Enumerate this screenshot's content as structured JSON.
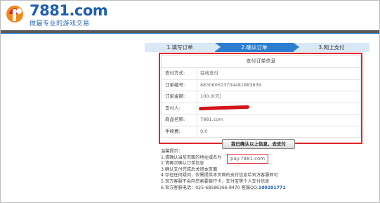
{
  "header": {
    "logo_name": "7881.com",
    "slogan": "做最专业的游戏交易",
    "colors": {
      "brand_blue": "#1e5fae",
      "logo_orange": "#f08a1c",
      "logo_red": "#d8272d"
    }
  },
  "steps": [
    {
      "label": "1.填写订单"
    },
    {
      "label": "2.确认订单",
      "active": true
    },
    {
      "label": "3.网上支付"
    }
  ],
  "order_info": {
    "title": "支付订单信息",
    "rows": [
      {
        "label": "支付方式:",
        "value": "在线支付"
      },
      {
        "label": "订单编号:",
        "value": "883060613704481883639"
      },
      {
        "label": "订单金额:",
        "value": "100.0(元)"
      },
      {
        "label": "支付人:",
        "value": ""
      },
      {
        "label": "商品名称:",
        "value": "7881.com"
      },
      {
        "label": "手续费:",
        "value": "0.0"
      }
    ],
    "confirm_button": "我已确认以上信息，去支付"
  },
  "tips": {
    "title": "温馨提示：",
    "line1": "1.请确认当前页面的地址域名为",
    "domain": "pay.7881.com",
    "line2": "2.请再次确认订单信息",
    "line3": "3.确认支付完成后关闭本页面",
    "line4": "4.存在任何疑问，仅需提供本页面的支付信息给官方客服即可",
    "line5": "5.官方客服不会向您索要银行卡，支付宝等个人支付信息",
    "line6_prefix": "6.官方客服电话：025-68586366-8470 客服QQ:",
    "qq": "100291771"
  },
  "highlight_color": "#e0262d"
}
